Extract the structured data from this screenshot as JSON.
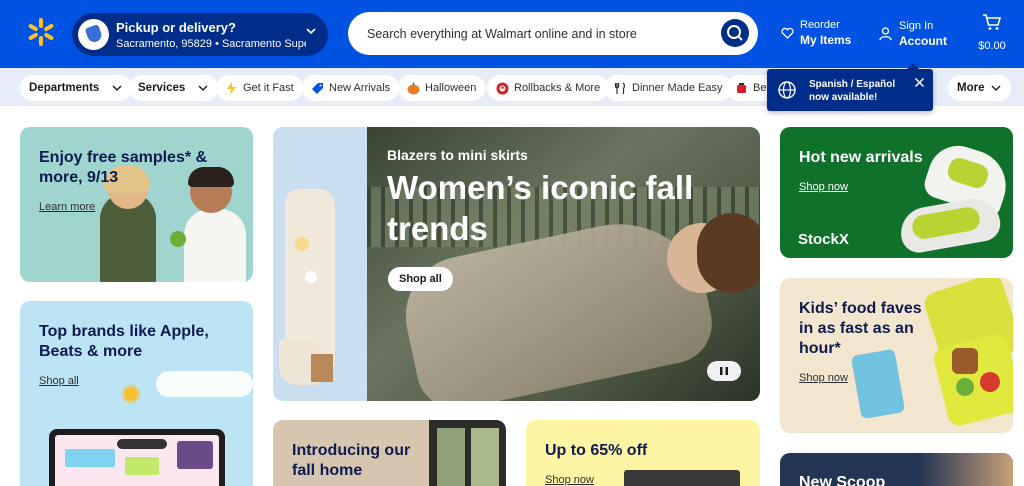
{
  "header": {
    "pickup_title": "Pickup or delivery?",
    "pickup_location": "Sacramento, 95829 • Sacramento Supe...",
    "search_placeholder": "Search everything at Walmart online and in store",
    "reorder_small": "Reorder",
    "reorder_big": "My Items",
    "signin_small": "Sign In",
    "signin_big": "Account",
    "cart_total": "$0.00"
  },
  "nav": {
    "departments": "Departments",
    "services": "Services",
    "items": [
      "Get it Fast",
      "New Arrivals",
      "Halloween",
      "Rollbacks & More",
      "Dinner Made Easy",
      "Bea"
    ],
    "more": "More"
  },
  "tooltip": {
    "line1": "Spanish / Español",
    "line2": "now available!"
  },
  "cards": {
    "samples": {
      "title": "Enjoy free samples* & more, 9/13",
      "link": "Learn more"
    },
    "brands": {
      "title": "Top brands like Apple, Beats & more",
      "link": "Shop all"
    },
    "hero": {
      "subtitle": "Blazers to mini skirts",
      "title": "Women’s iconic fall trends",
      "button": "Shop all"
    },
    "hot": {
      "title": "Hot new arrivals",
      "link": "Shop now",
      "brand": "StockX"
    },
    "kids": {
      "title": "Kids’ food faves in as fast as an hour*",
      "link": "Shop now"
    },
    "home": {
      "title": "Introducing our fall home"
    },
    "sale": {
      "title": "Up to 65% off",
      "link": "Shop now"
    },
    "scoop": {
      "title": "New Scoop"
    }
  },
  "colors": {
    "header_blue": "#0053e2",
    "dark_blue": "#002d8a",
    "spark_yellow": "#ffc220",
    "nav_bg": "#e6edf9"
  }
}
